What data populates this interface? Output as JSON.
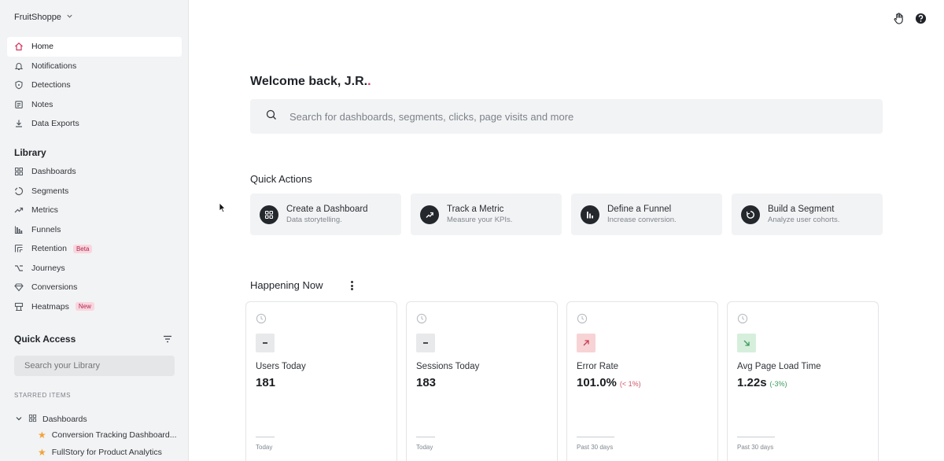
{
  "org": {
    "name": "FruitShoppe"
  },
  "nav": [
    {
      "label": "Home",
      "icon": "home-icon",
      "active": true
    },
    {
      "label": "Notifications",
      "icon": "bell-icon"
    },
    {
      "label": "Detections",
      "icon": "shield-icon"
    },
    {
      "label": "Notes",
      "icon": "note-icon"
    },
    {
      "label": "Data Exports",
      "icon": "download-icon"
    }
  ],
  "library": {
    "title": "Library",
    "items": [
      {
        "label": "Dashboards",
        "icon": "grid-icon"
      },
      {
        "label": "Segments",
        "icon": "segment-icon"
      },
      {
        "label": "Metrics",
        "icon": "trend-icon"
      },
      {
        "label": "Funnels",
        "icon": "funnel-bars-icon"
      },
      {
        "label": "Retention",
        "icon": "retention-icon",
        "badge": "Beta"
      },
      {
        "label": "Journeys",
        "icon": "journey-icon"
      },
      {
        "label": "Conversions",
        "icon": "diamond-icon"
      },
      {
        "label": "Heatmaps",
        "icon": "heatmap-icon",
        "badge": "New"
      }
    ]
  },
  "quick_access": {
    "title": "Quick Access",
    "search_placeholder": "Search your Library",
    "starred_label": "STARRED ITEMS",
    "folder": "Dashboards",
    "starred": [
      "Conversion Tracking Dashboard...",
      "FullStory for Product Analytics"
    ]
  },
  "main": {
    "welcome": "Welcome back, J.R.",
    "welcome_dot": ".",
    "search_placeholder": "Search for dashboards, segments, clicks, page visits and more",
    "quick_actions_title": "Quick Actions",
    "quick_actions": [
      {
        "title": "Create a Dashboard",
        "sub": "Data storytelling.",
        "icon": "dashboard-icon"
      },
      {
        "title": "Track a Metric",
        "sub": "Measure your KPIs.",
        "icon": "trend-up-icon"
      },
      {
        "title": "Define a Funnel",
        "sub": "Increase conversion.",
        "icon": "bar-chart-icon"
      },
      {
        "title": "Build a Segment",
        "sub": "Analyze user cohorts.",
        "icon": "refresh-icon"
      }
    ],
    "happening_title": "Happening Now",
    "metrics": [
      {
        "label": "Users Today",
        "value": "181",
        "delta": "",
        "trend": "flat",
        "foot": "Today"
      },
      {
        "label": "Sessions Today",
        "value": "183",
        "delta": "",
        "trend": "flat",
        "foot": "Today"
      },
      {
        "label": "Error Rate",
        "value": "101.0%",
        "delta": "(< 1%)",
        "trend": "up",
        "foot": "Past 30 days"
      },
      {
        "label": "Avg Page Load Time",
        "value": "1.22s",
        "delta": "(-3%)",
        "trend": "down",
        "foot": "Past 30 days"
      }
    ]
  },
  "colors": {
    "accent": "#d1365f",
    "sidebar_bg": "#f2f3f4",
    "card_bg": "#f2f3f4"
  }
}
